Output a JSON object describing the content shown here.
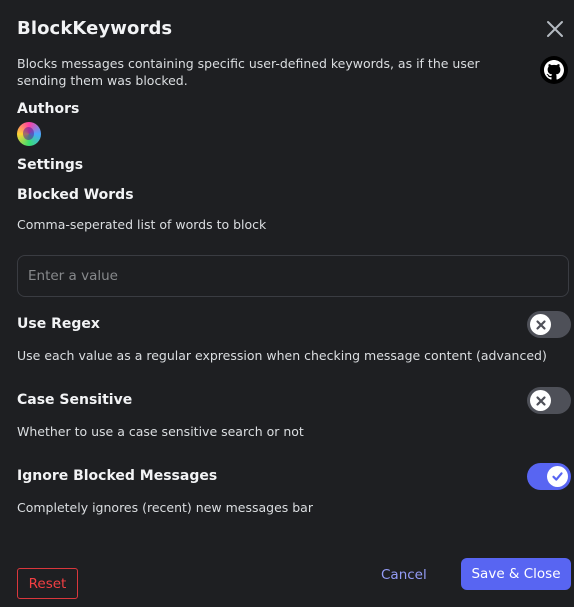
{
  "modal": {
    "title": "BlockKeywords",
    "description": "Blocks messages containing specific user-defined keywords, as if the user sending them was blocked.",
    "authors_heading": "Authors",
    "settings_heading": "Settings"
  },
  "settings": {
    "blocked_words": {
      "label": "Blocked Words",
      "description": "Comma-seperated list of words to block",
      "value": "",
      "placeholder": "Enter a value"
    },
    "use_regex": {
      "label": "Use Regex",
      "description": "Use each value as a regular expression when checking message content (advanced)",
      "enabled": false
    },
    "case_sensitive": {
      "label": "Case Sensitive",
      "description": "Whether to use a case sensitive search or not",
      "enabled": false
    },
    "ignore_blocked_messages": {
      "label": "Ignore Blocked Messages",
      "description": "Completely ignores (recent) new messages bar",
      "enabled": true
    }
  },
  "footer": {
    "reset_label": "Reset",
    "cancel_label": "Cancel",
    "save_label": "Save & Close"
  },
  "icons": {
    "close": "close-icon",
    "github": "github-icon",
    "toggle_off": "x-icon",
    "toggle_on": "check-icon"
  },
  "colors": {
    "background": "#1e1f22",
    "accent": "#5865f2",
    "danger": "#da373c",
    "link": "#949cf7",
    "toggle_off": "#4e5058"
  }
}
